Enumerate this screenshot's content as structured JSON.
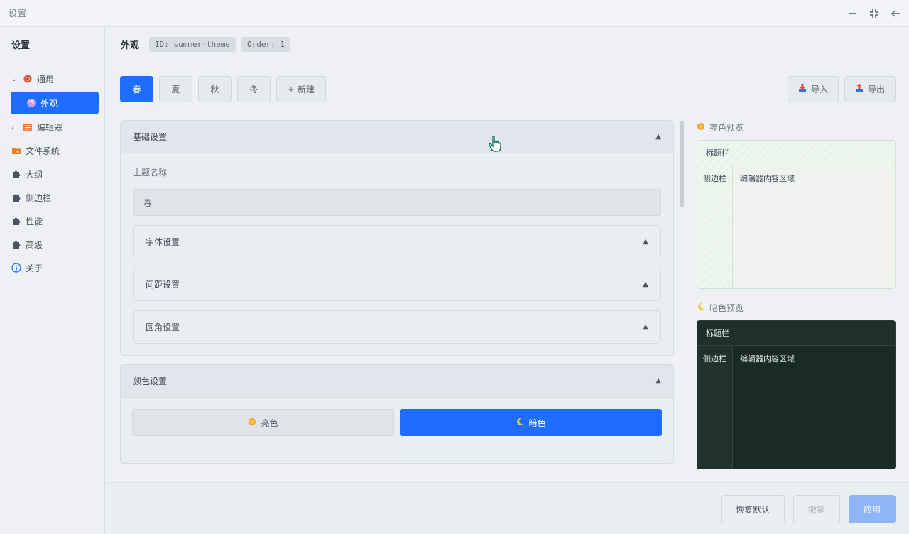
{
  "window": {
    "title": "设置"
  },
  "sidebar": {
    "header": "设置",
    "items": [
      {
        "label": "通用",
        "icon": "gear-icon",
        "expanded": true
      },
      {
        "label": "外观",
        "icon": "palette-icon",
        "active": true
      },
      {
        "label": "编辑器",
        "icon": "editor-icon",
        "expanded": false
      },
      {
        "label": "文件系统",
        "icon": "folder-icon"
      },
      {
        "label": "大纲",
        "icon": "puzzle-icon"
      },
      {
        "label": "侧边栏",
        "icon": "puzzle-icon"
      },
      {
        "label": "性能",
        "icon": "puzzle-icon"
      },
      {
        "label": "高级",
        "icon": "puzzle-icon"
      },
      {
        "label": "关于",
        "icon": "info-icon"
      }
    ]
  },
  "topbar": {
    "title": "外观",
    "id_chip": "ID: summer-theme",
    "order_chip": "Order: 1"
  },
  "tabs": [
    {
      "label": "春",
      "active": true
    },
    {
      "label": "夏"
    },
    {
      "label": "秋"
    },
    {
      "label": "冬"
    },
    {
      "label": "+ 新建"
    }
  ],
  "io": {
    "import_label": "导入",
    "export_label": "导出"
  },
  "basic": {
    "title": "基础设置",
    "name_label": "主题名称",
    "name_value": "春",
    "subsections": [
      "字体设置",
      "间距设置",
      "圆角设置"
    ]
  },
  "colors": {
    "title": "颜色设置",
    "light_label": "亮色",
    "dark_label": "暗色",
    "active_mode": "dark"
  },
  "preview_light": {
    "label": "亮色预览",
    "titlebar": "标题栏",
    "sidebar": "侧边栏",
    "editor": "编辑器内容区域"
  },
  "preview_dark": {
    "label": "暗色预览",
    "titlebar": "标题栏",
    "sidebar": "侧边栏",
    "editor": "编辑器内容区域"
  },
  "footer": {
    "reset_label": "恢复默认",
    "undo_label": "撤销",
    "apply_label": "应用"
  },
  "colors_theme": {
    "accent": "#1f6dff",
    "dark_preview_bg": "#1c2b24",
    "light_preview_border": "#cfe3d3"
  }
}
